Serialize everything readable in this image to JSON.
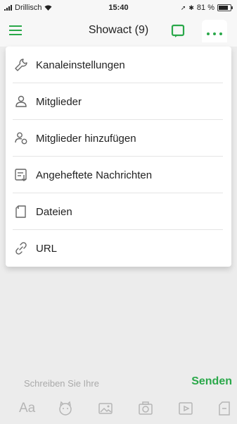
{
  "status_bar": {
    "carrier": "Drillisch",
    "time": "15:40",
    "battery": "81 %",
    "battery_level": 0.81
  },
  "nav": {
    "title": "Showact (9)"
  },
  "menu": {
    "items": [
      {
        "label": "Kanaleinstellungen",
        "icon": "wrench-icon"
      },
      {
        "label": "Mitglieder",
        "icon": "person-icon"
      },
      {
        "label": "Mitglieder hinzufügen",
        "icon": "add-person-icon"
      },
      {
        "label": "Angeheftete Nachrichten",
        "icon": "pinned-messages-icon"
      },
      {
        "label": "Dateien",
        "icon": "file-icon"
      },
      {
        "label": "URL",
        "icon": "link-icon"
      }
    ]
  },
  "composer": {
    "placeholder": "Schreiben Sie Ihre",
    "send_label": "Senden",
    "toolbar": {
      "text_format": "Aa"
    }
  },
  "colors": {
    "accent": "#2aa84a",
    "icon_grey": "#b5b5b5"
  }
}
